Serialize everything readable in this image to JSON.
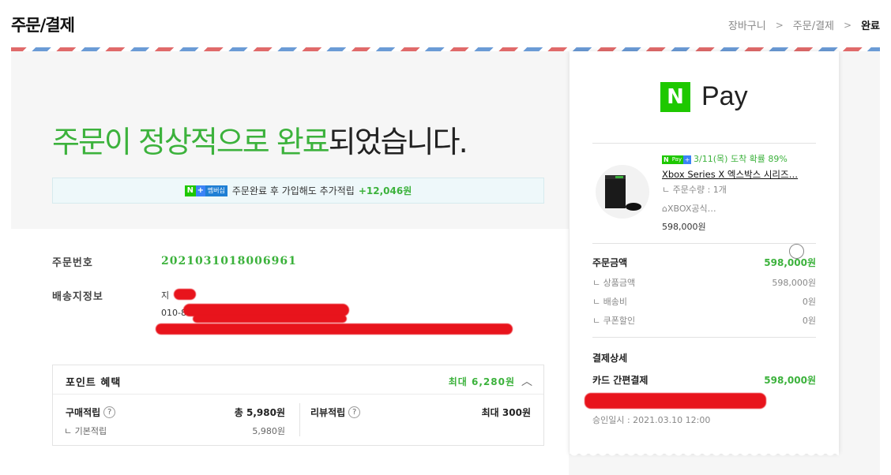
{
  "header": {
    "title": "주문/결제",
    "breadcrumb": [
      "장바구니",
      "주문/결제",
      "완료"
    ]
  },
  "hero": {
    "title_green": "주문이 정상적으로 완료",
    "title_rest": "되었습니다.",
    "member_badge": "멤버십",
    "member_text": "주문완료 후 가입해도 추가적립",
    "member_points": "+12,046원"
  },
  "order_info": {
    "order_no_label": "주문번호",
    "order_no": "2021031018006961",
    "shipping_label": "배송지정보",
    "shipping_name": "지",
    "shipping_phone": "010-8"
  },
  "points": {
    "title": "포인트 혜택",
    "max_text": "최대 6,280원",
    "purchase_label": "구매적립",
    "purchase_value": "총 5,980원",
    "basic_label": "ㄴ 기본적립",
    "basic_value": "5,980원",
    "review_label": "리뷰적립",
    "review_value": "최대 300원"
  },
  "receipt": {
    "logo_n": "N",
    "logo_pay": "Pay",
    "delivery_text": "3/11(목) 도착 확률 89%",
    "product_name": "Xbox Series X 엑스박스 시리즈…",
    "quantity": "ㄴ 주문수량 : 1개",
    "seller": "XBOX공식…",
    "price": "598,000원",
    "order_amount_label": "주문금액",
    "order_amount": "598,000원",
    "product_amount_label": "ㄴ 상품금액",
    "product_amount": "598,000원",
    "shipping_fee_label": "ㄴ 배송비",
    "shipping_fee": "0원",
    "coupon_label": "ㄴ 쿠폰할인",
    "coupon": "0원",
    "payment_detail_label": "결제상세",
    "card_label": "카드 간편결제",
    "card_amount": "598,000원",
    "approved": "승인일시 : 2021.03.10 12:00"
  },
  "colors": {
    "accent_green": "#3cb23c",
    "naver_green": "#1ec800",
    "redact": "#e8141c"
  }
}
